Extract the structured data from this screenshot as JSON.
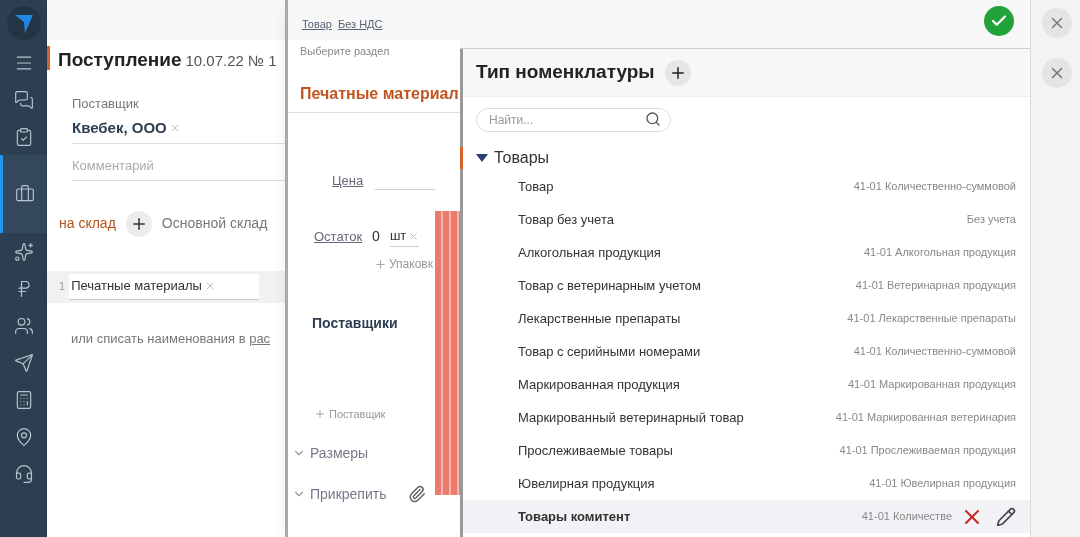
{
  "sidebar": {
    "items": [
      {
        "kind": "menu",
        "selected": false
      },
      {
        "kind": "chat",
        "selected": false
      },
      {
        "kind": "tasks",
        "selected": false
      },
      {
        "kind": "briefcase",
        "selected": true
      },
      {
        "kind": "spark",
        "selected": false
      },
      {
        "kind": "ruble",
        "selected": false
      },
      {
        "kind": "people",
        "selected": false
      },
      {
        "kind": "send",
        "selected": false
      },
      {
        "kind": "calculator",
        "selected": false
      },
      {
        "kind": "map",
        "selected": false
      },
      {
        "kind": "support",
        "selected": false
      }
    ]
  },
  "document": {
    "title": "Поступление",
    "date": "10.07.22",
    "number": "№ 1",
    "supplier_label": "Поставщик",
    "supplier": "Квебек, ООО",
    "comment_placeholder": "Комментарий",
    "warehouse_label": "на склад",
    "warehouse": "Основной склад",
    "line_index": "1",
    "line_item": "Печатные материалы",
    "footer_text": "или списать наименования в ",
    "footer_link": "рас"
  },
  "item_card": {
    "breadcrumbs": [
      "Товар",
      "Без НДС"
    ],
    "section_hint": "Выберите раздел",
    "title": "Печатные материал",
    "price_label": "Цена",
    "stock_label": "Остаток",
    "stock_value": "0",
    "unit": "шт",
    "add_package": "Упаковк",
    "suppliers_title": "Поставщики",
    "add_supplier": "Поставщик",
    "sections": [
      {
        "label": "Размеры",
        "expanded": false
      },
      {
        "label": "Прикрепить",
        "expanded": false
      }
    ]
  },
  "type_picker": {
    "title": "Тип номенклатуры",
    "search_placeholder": "Найти...",
    "group": {
      "label": "Товары",
      "expanded": true,
      "items": [
        {
          "name": "Товар",
          "account": "41-01 Количественно-суммовой",
          "selected": false
        },
        {
          "name": "Товар без учета",
          "account": "Без учета",
          "selected": false
        },
        {
          "name": "Алкогольная продукция",
          "account": "41-01 Алкогольная продукция",
          "selected": false
        },
        {
          "name": "Товар с ветеринарным учетом",
          "account": "41-01 Ветеринарная продукция",
          "selected": false
        },
        {
          "name": "Лекарственные препараты",
          "account": "41-01 Лекарственные препараты",
          "selected": false
        },
        {
          "name": "Товар с серийными номерами",
          "account": "41-01 Количественно-суммовой",
          "selected": false
        },
        {
          "name": "Маркированная продукция",
          "account": "41-01 Маркированная продукция",
          "selected": false
        },
        {
          "name": "Маркированный ветеринарный товар",
          "account": "41-01 Маркированная ветеринария",
          "selected": false
        },
        {
          "name": "Прослеживаемые товары",
          "account": "41-01 Прослеживаемая продукция",
          "selected": false
        },
        {
          "name": "Ювелирная продукция",
          "account": "41-01 Ювелирная продукция",
          "selected": false
        },
        {
          "name": "Товары комитент",
          "account": "41-01 Количестве",
          "selected": true
        }
      ]
    }
  }
}
